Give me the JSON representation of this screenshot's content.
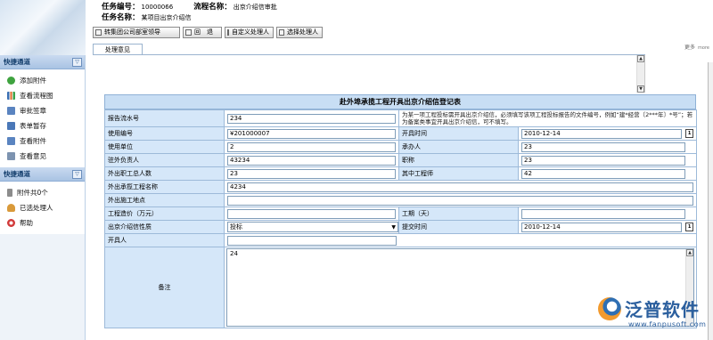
{
  "header": {
    "task_no_label": "任务编号：",
    "task_no_value": "10000066",
    "flow_name_label": "流程名称：",
    "flow_name_value": "出京介绍信审批",
    "task_name_label": "任务名称：",
    "task_name_value": "某项目出京介绍信"
  },
  "toolbar": {
    "forward": "转集团公司部室领导",
    "back": "回　退",
    "custom": "自定义处理人",
    "select": "选择处理人"
  },
  "more": {
    "label": "更多",
    "key": "more"
  },
  "tabs": {
    "opinion": "处理意见"
  },
  "nav": {
    "section1_title": "快捷通道",
    "section1_items": [
      {
        "label": "添加附件",
        "icon": "add-attachment-icon"
      },
      {
        "label": "查看流程图",
        "icon": "flowchart-icon"
      },
      {
        "label": "审批签章",
        "icon": "seal-icon"
      },
      {
        "label": "表单暂存",
        "icon": "save-icon"
      },
      {
        "label": "查看附件",
        "icon": "attachment-icon"
      },
      {
        "label": "查看意见",
        "icon": "opinion-icon"
      }
    ],
    "section2_title": "快捷通道",
    "section2_items": [
      {
        "label": "附件共0个",
        "icon": "paperclip-icon"
      },
      {
        "label": "已选处理人",
        "icon": "user-icon"
      },
      {
        "label": "帮助",
        "icon": "help-icon"
      }
    ]
  },
  "form": {
    "title": "赴外埠承揽工程开具出京介绍信登记表",
    "labels": {
      "report_no": "报告流水号",
      "use_no": "使用编号",
      "start_time": "开具时间",
      "use_unit": "使用单位",
      "handler": "承办人",
      "resident_lead": "驻外负责人",
      "title": "职称",
      "staff_count": "外出职工总人数",
      "engineers": "其中工程师",
      "project_name": "外出承揽工程名称",
      "construction_site": "外出施工地点",
      "project_cost": "工程造价（万元）",
      "duration": "工期（天）",
      "letter_nature": "出京介绍信性质",
      "submit_time": "提交时间",
      "issuer": "开具人",
      "remark": "备注"
    },
    "values": {
      "report_no": "234",
      "report_no_note": "为某一项工程投标需开具出京介绍信，必须填写该项工程投标报告的文件编号，例如“建*经营〔2***年〕*号”；若为备案类事宜开具出京介绍信，可不填写。",
      "use_no": "¥201000007",
      "start_time": "2010-12-14",
      "use_unit": "2",
      "handler": "23",
      "resident_lead": "43234",
      "title": "23",
      "staff_count": "23",
      "engineers": "42",
      "project_name": "4234",
      "construction_site": "",
      "project_cost": "",
      "duration": "",
      "letter_nature": "投标",
      "submit_time": "2010-12-14",
      "issuer": "",
      "remark": "24"
    }
  },
  "watermark": {
    "brand": "泛普软件",
    "url": "www.fanpusoft.com"
  }
}
